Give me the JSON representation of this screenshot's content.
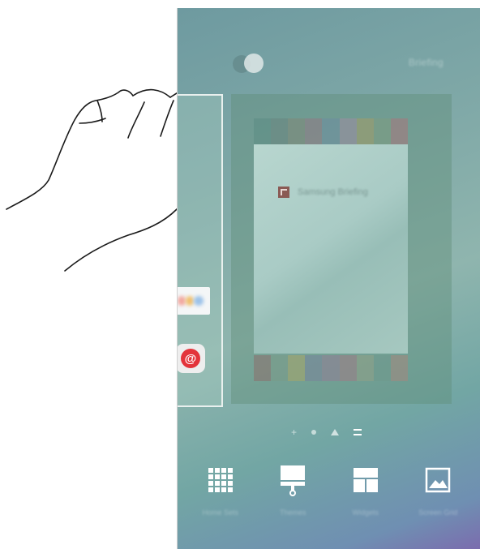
{
  "screen": {
    "title": "Briefing",
    "left_page": {
      "widget": "left-page-widget",
      "app_icon": "@"
    },
    "current_page": {
      "widget_title": "Samsung Briefing",
      "strip_colors_top": [
        "#5e8e86",
        "#6a8680",
        "#7e8a7a",
        "#8f7d86",
        "#6e8fa0",
        "#9a8ea0",
        "#9e9c6a",
        "#7d9c82",
        "#a47a7e"
      ],
      "strip_colors_bottom": [
        "#8a7470",
        "#7a9c8a",
        "#a3a56c",
        "#78879a",
        "#8f8094",
        "#9b7e86",
        "#8ea088",
        "#6f9a8e",
        "#a08a80"
      ]
    },
    "page_indicator": {
      "add": "+",
      "items": [
        "dot",
        "home",
        "active"
      ]
    },
    "options": [
      {
        "icon": "apps-grid-icon",
        "label": "Home Sets"
      },
      {
        "icon": "wallpaper-brush-icon",
        "label": "Themes"
      },
      {
        "icon": "widgets-icon",
        "label": "Widgets"
      },
      {
        "icon": "image-icon",
        "label": "Screen Grid"
      }
    ]
  }
}
